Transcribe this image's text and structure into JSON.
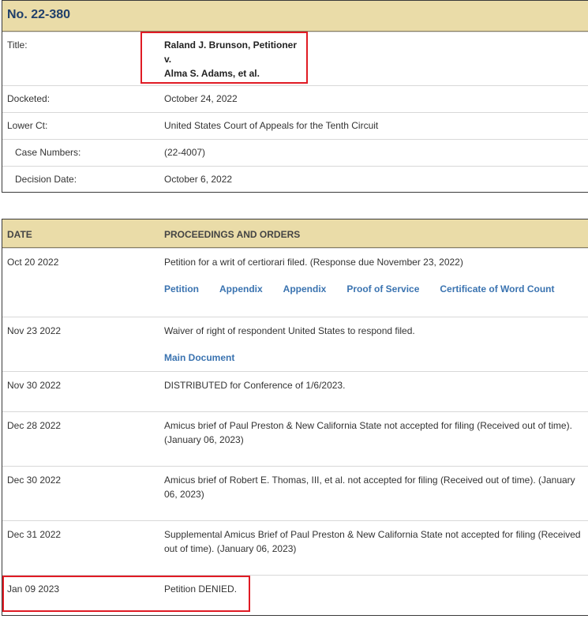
{
  "case": {
    "number": "No. 22-380",
    "info": [
      {
        "label": "Title:",
        "lines": [
          "Raland J. Brunson, Petitioner",
          "v.",
          "Alma S. Adams, et al."
        ]
      },
      {
        "label": "Docketed:",
        "value": "October 24, 2022"
      },
      {
        "label": "Lower Ct:",
        "value": "United States Court of Appeals for the Tenth Circuit"
      },
      {
        "label": "Case Numbers:",
        "value": "(22-4007)"
      },
      {
        "label": "Decision Date:",
        "value": "October 6, 2022"
      }
    ]
  },
  "proceedings": {
    "headers": {
      "date": "DATE",
      "entry": "PROCEEDINGS AND ORDERS"
    },
    "rows": [
      {
        "date": "Oct 20 2022",
        "text": "Petition for a writ of certiorari filed. (Response due November 23, 2022)",
        "links": [
          "Petition",
          "Appendix",
          "Appendix",
          "Proof of Service",
          "Certificate of Word Count"
        ]
      },
      {
        "date": "Nov 23 2022",
        "text": "Waiver of right of respondent United States to respond filed.",
        "links": [
          "Main Document"
        ]
      },
      {
        "date": "Nov 30 2022",
        "text": "DISTRIBUTED for Conference of 1/6/2023."
      },
      {
        "date": "Dec 28 2022",
        "text": "Amicus brief of Paul Preston & New California State not accepted for filing (Received out of time). (January 06, 2023)"
      },
      {
        "date": "Dec 30 2022",
        "text": "Amicus brief of Robert E. Thomas, III, et al. not accepted for filing (Received out of time). (January 06, 2023)"
      },
      {
        "date": "Dec 31 2022",
        "text": "Supplemental Amicus Brief of Paul Preston & New California State not accepted for filing (Received out of time). (January 06, 2023)"
      },
      {
        "date": "Jan 09 2023",
        "text": "Petition DENIED."
      }
    ]
  },
  "colors": {
    "header_bg": "#eadca8",
    "title": "#1f3f6a",
    "link": "#3a73b0",
    "highlight": "#e01b24"
  }
}
